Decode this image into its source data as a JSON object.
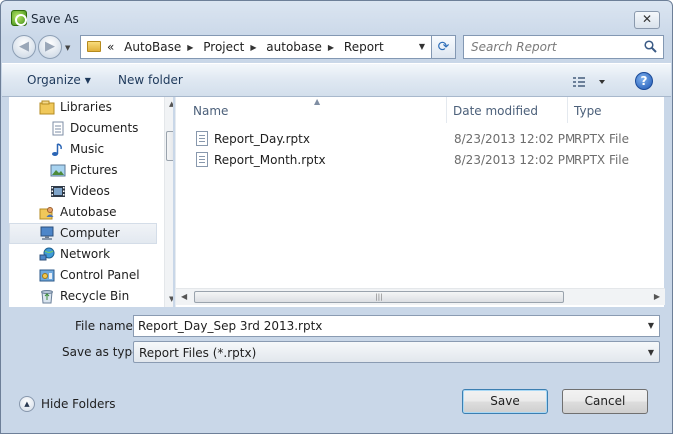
{
  "window": {
    "title": "Save As"
  },
  "address": {
    "overflow": "«",
    "crumbs": [
      "AutoBase",
      "Project",
      "autobase",
      "Report"
    ]
  },
  "search": {
    "placeholder": "Search Report"
  },
  "toolbar": {
    "organize_label": "Organize",
    "new_folder_label": "New folder",
    "help_label": "?"
  },
  "nav": {
    "items": [
      {
        "label": "Libraries",
        "icon": "libraries-icon"
      },
      {
        "label": "Documents",
        "icon": "documents-icon"
      },
      {
        "label": "Music",
        "icon": "music-icon"
      },
      {
        "label": "Pictures",
        "icon": "pictures-icon"
      },
      {
        "label": "Videos",
        "icon": "videos-icon"
      },
      {
        "label": "Autobase",
        "icon": "user-folder-icon"
      },
      {
        "label": "Computer",
        "icon": "computer-icon"
      },
      {
        "label": "Network",
        "icon": "network-icon"
      },
      {
        "label": "Control Panel",
        "icon": "control-panel-icon"
      },
      {
        "label": "Recycle Bin",
        "icon": "recycle-bin-icon"
      }
    ]
  },
  "filelist": {
    "columns": {
      "name": "Name",
      "date": "Date modified",
      "type": "Type"
    },
    "rows": [
      {
        "name": "Report_Day.rptx",
        "date": "8/23/2013 12:02 PM",
        "type": "RPTX File"
      },
      {
        "name": "Report_Month.rptx",
        "date": "8/23/2013 12:02 PM",
        "type": "RPTX File"
      }
    ]
  },
  "form": {
    "file_name_label": "File name:",
    "file_name_value": "Report_Day_Sep 3rd 2013.rptx",
    "save_type_label": "Save as type:",
    "save_type_value": "Report Files (*.rptx)"
  },
  "footer": {
    "hide_folders_label": "Hide Folders",
    "save_label": "Save",
    "cancel_label": "Cancel"
  },
  "colors": {
    "accent": "#1d56b3",
    "frame": "#c9d7e8",
    "selection": "#e3e9f0"
  }
}
